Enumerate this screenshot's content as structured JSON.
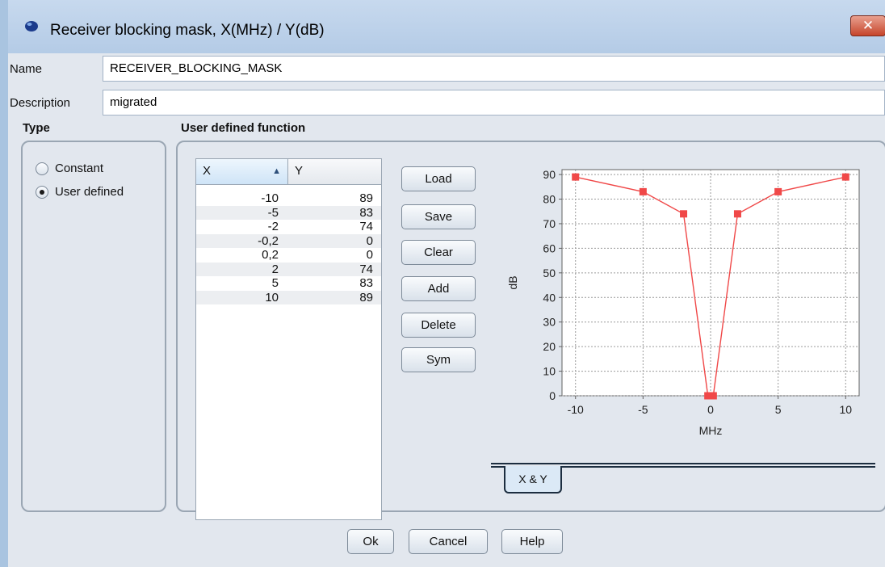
{
  "window": {
    "title": "Receiver blocking mask, X(MHz) / Y(dB)",
    "close_label": "✕"
  },
  "form": {
    "name_label": "Name",
    "name_value": "RECEIVER_BLOCKING_MASK",
    "description_label": "Description",
    "description_value": "migrated"
  },
  "type_section": {
    "label": "Type",
    "options": [
      {
        "label": "Constant",
        "selected": false
      },
      {
        "label": "User defined",
        "selected": true
      }
    ]
  },
  "udf_section": {
    "label": "User defined function"
  },
  "table": {
    "headers": {
      "x": "X",
      "y": "Y"
    },
    "sort_indicator": "▲",
    "rows": [
      {
        "x": "-10",
        "y": "89"
      },
      {
        "x": "-5",
        "y": "83"
      },
      {
        "x": "-2",
        "y": "74"
      },
      {
        "x": "-0,2",
        "y": "0"
      },
      {
        "x": "0,2",
        "y": "0"
      },
      {
        "x": "2",
        "y": "74"
      },
      {
        "x": "5",
        "y": "83"
      },
      {
        "x": "10",
        "y": "89"
      }
    ]
  },
  "side_buttons": [
    "Load",
    "Save",
    "Clear",
    "Add",
    "Delete",
    "Sym"
  ],
  "chart_data": {
    "type": "line",
    "x": [
      -10,
      -5,
      -2,
      -0.2,
      0.2,
      2,
      5,
      10
    ],
    "y": [
      89,
      83,
      74,
      0,
      0,
      74,
      83,
      89
    ],
    "xlabel": "MHz",
    "ylabel": "dB",
    "xlim": [
      -11,
      11
    ],
    "ylim": [
      0,
      92
    ],
    "xticks": [
      -10,
      -5,
      0,
      5,
      10
    ],
    "xtick_labels": [
      "-10",
      "-5",
      "0",
      "5",
      "10"
    ],
    "yticks": [
      0,
      10,
      20,
      30,
      40,
      50,
      60,
      70,
      80,
      90
    ],
    "ytick_labels": [
      "0",
      "10",
      "20",
      "30",
      "40",
      "50",
      "60",
      "70",
      "80",
      "90"
    ],
    "grid": true,
    "series_color": "#f04848"
  },
  "tab": {
    "label": "X & Y"
  },
  "footer_buttons": {
    "ok": "Ok",
    "cancel": "Cancel",
    "help": "Help"
  }
}
